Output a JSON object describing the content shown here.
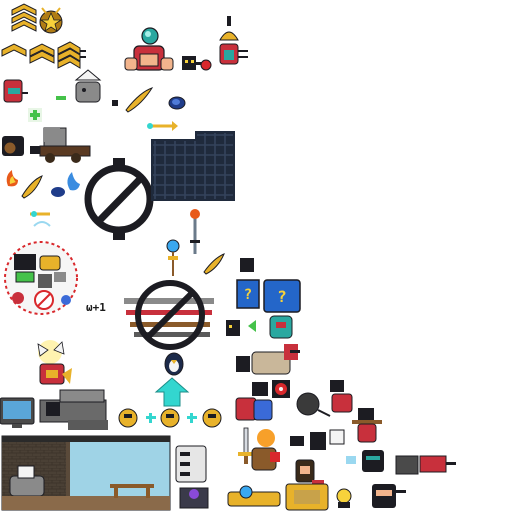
{
  "sheet": {
    "background": "#ffffff"
  },
  "colors": {
    "outline": "#1c1c22",
    "gold": "#e8b22a",
    "gold_dark": "#b07c14",
    "skin": "#f2b48c",
    "red_hair": "#c8303c",
    "teal": "#2aa8a0",
    "navy_panel": "#1f2a3c",
    "cyan_arrow": "#33d6cf",
    "blue_box": "#2466c9",
    "question_yellow": "#f7d23b",
    "green_plus": "#45c24a",
    "no_sign_red": "#d9282c",
    "scene_sky": "#9fd3e6",
    "scene_wall": "#5a4a3a",
    "wood": "#8a5a2a",
    "monitor_blue": "#5aa6d8"
  },
  "texts": {
    "unit_label": "ω+1"
  },
  "icons": [
    "rank-chevron-icon",
    "star-medal-icon",
    "no-entry-icon",
    "ornate-panel-icon",
    "question-crate-icon",
    "up-arrow-icon",
    "bomb-icon",
    "sword-icon",
    "shield-icon",
    "monitor-icon",
    "green-plus-icon",
    "blue-orb-icon",
    "feather-icon",
    "blue-flame-icon",
    "fire-icon",
    "target-icon"
  ]
}
